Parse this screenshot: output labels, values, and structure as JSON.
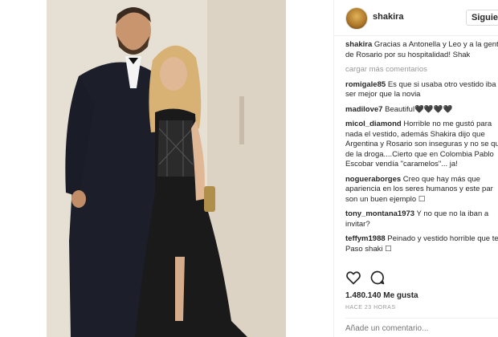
{
  "post": {
    "username": "shakira",
    "follow_label": "Siguiendo",
    "load_more": "cargar más comentarios",
    "comments": [
      {
        "user": "shakira",
        "text": "Gracias a Antonella y Leo y a la gente de Rosario por su hospitalidad! Shak"
      },
      {
        "user": "romigale85",
        "text": "Es que si usaba otro vestido iba a ser mejor que la novia"
      },
      {
        "user": "madilove7",
        "text": "Beautiful🖤🖤🖤🖤"
      },
      {
        "user": "micol_diamond",
        "text": "Horrible no me gustó para nada el vestido, además Shakira dijo que Argentina y Rosario son inseguras y no se que de la droga....Cierto que en Colombia Pablo Escobar vendía \"caramelos\"... ja!"
      },
      {
        "user": "nogueraborges",
        "text": "Creo que hay más que apariencia en los seres humanos y este par son un buen ejemplo ☐"
      },
      {
        "user": "tony_montana1973",
        "text": "Y no que no la iban a invitar?"
      },
      {
        "user": "teffym1988",
        "text": "Peinado y vestido horrible que te Paso shaki ☐"
      }
    ],
    "likes": "1.480.140 Me gusta",
    "time": "HACE 23 HORAS",
    "add_comment_placeholder": "Añade un comentario..."
  },
  "icons": {
    "like": "heart-outline-icon",
    "comment": "speech-bubble-icon"
  },
  "colors": {
    "text": "#262626",
    "muted": "#999999",
    "border": "#efefef"
  }
}
